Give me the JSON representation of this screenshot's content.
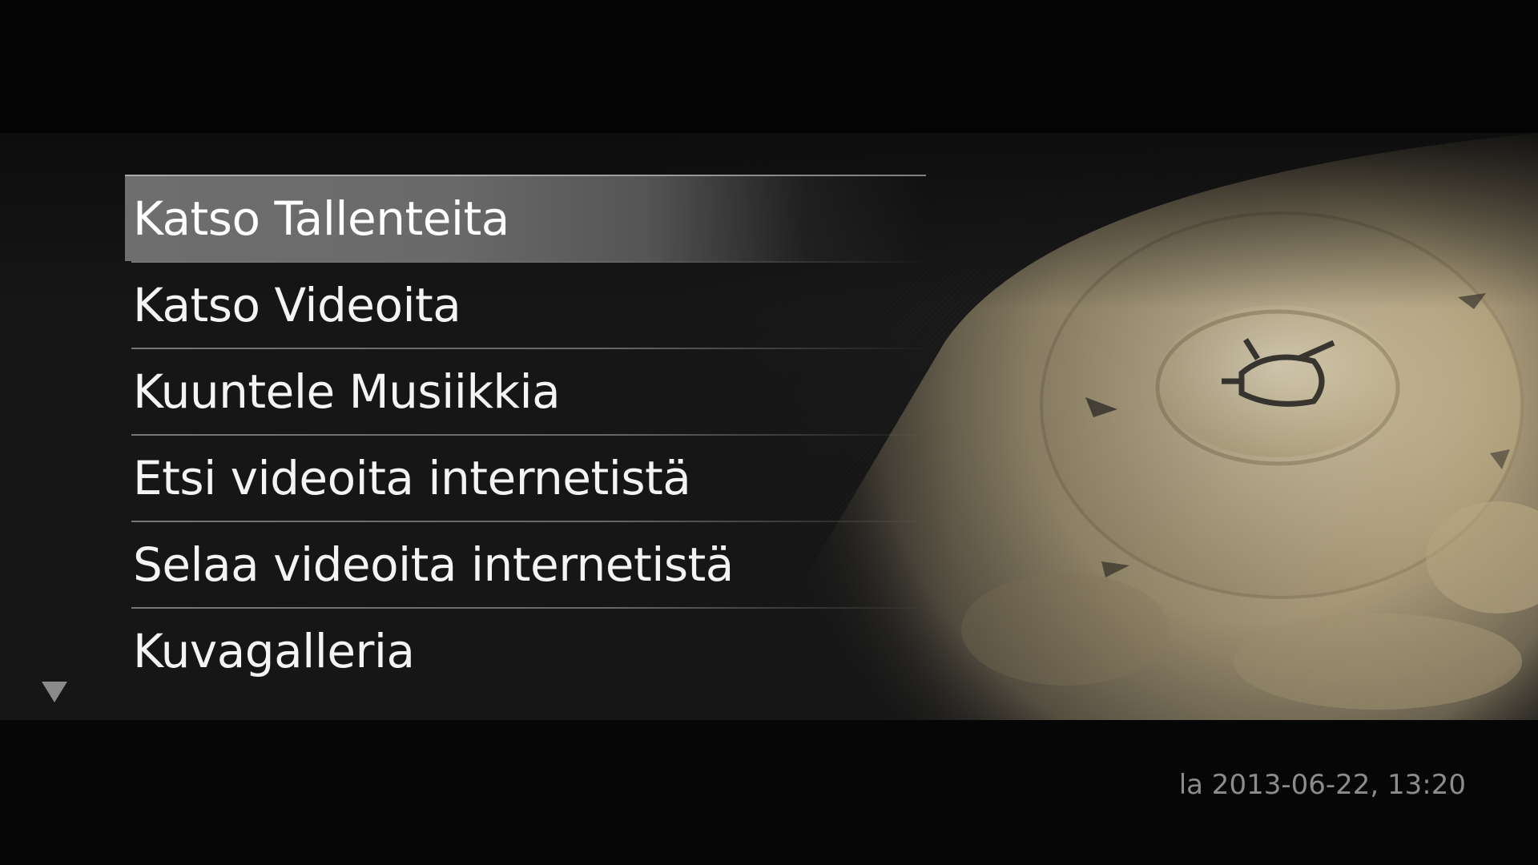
{
  "menu": {
    "items": [
      {
        "label": "Katso Tallenteita",
        "selected": true
      },
      {
        "label": "Katso Videoita",
        "selected": false
      },
      {
        "label": "Kuuntele Musiikkia",
        "selected": false
      },
      {
        "label": "Etsi videoita internetistä",
        "selected": false
      },
      {
        "label": "Selaa videoita internetistä",
        "selected": false
      },
      {
        "label": "Kuvagalleria",
        "selected": false
      }
    ]
  },
  "scroll_indicator": {
    "icon": "triangle-down-icon"
  },
  "status": {
    "datetime": "la 2013-06-22, 13:20"
  },
  "background": {
    "image": "remote-control-photo",
    "icon": "tv-icon"
  },
  "colors": {
    "background": "#050505",
    "text": "#f4f4f4",
    "highlight": "#6e6e6e",
    "datetime": "#8c8c8c"
  }
}
